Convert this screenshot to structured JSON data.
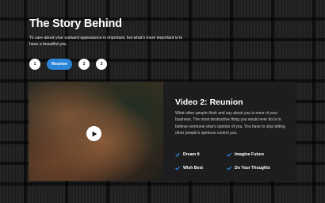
{
  "hero": {
    "title": "The Story Behind",
    "intro": "To care about your outward appearance is important, but what's more important is to have a beautiful you."
  },
  "tabs": [
    {
      "label": "1",
      "active": false
    },
    {
      "label": "Reunion",
      "active": true
    },
    {
      "label": "2",
      "active": false
    },
    {
      "label": "3",
      "active": false
    }
  ],
  "video": {
    "title": "Video 2: Reunion",
    "description": "What other people think and say about you is none of your business. The most destructive thing you would ever do is to believe someone else's opinion of you. You have to stop letting other people's opinions control you.",
    "features": [
      "Dream It",
      "Imagine Future",
      "Wish Best",
      "Do Your Thoughts"
    ]
  },
  "colors": {
    "accent": "#2a84d8",
    "check": "#2a84d8",
    "card": "#1d1d1f"
  },
  "icons": {
    "play": "play-icon",
    "check": "check-icon"
  }
}
